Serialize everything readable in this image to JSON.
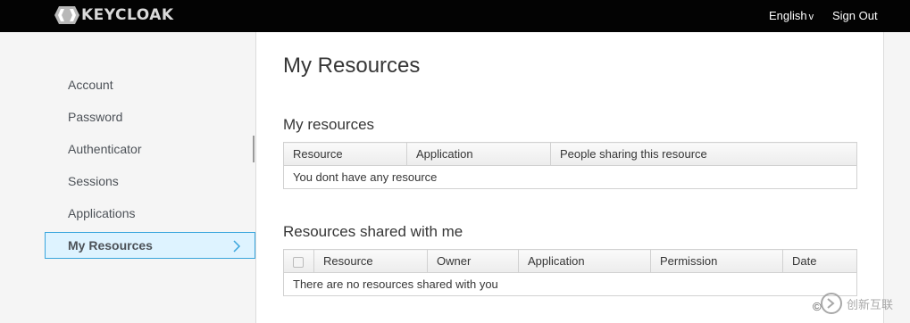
{
  "header": {
    "brand": "KEYCLOAK",
    "language": "English",
    "signout_label": "Sign Out"
  },
  "sidebar": {
    "items": [
      {
        "label": "Account"
      },
      {
        "label": "Password"
      },
      {
        "label": "Authenticator"
      },
      {
        "label": "Sessions"
      },
      {
        "label": "Applications"
      },
      {
        "label": "My Resources"
      }
    ]
  },
  "main": {
    "title": "My Resources",
    "my_resources": {
      "title": "My resources",
      "columns": [
        "Resource",
        "Application",
        "People sharing this resource"
      ],
      "empty": "You dont have any resource"
    },
    "shared_with_me": {
      "title": "Resources shared with me",
      "columns": [
        "Resource",
        "Owner",
        "Application",
        "Permission",
        "Date"
      ],
      "empty": "There are no resources shared with you"
    }
  },
  "watermark": {
    "text": "创新互联"
  },
  "colors": {
    "topbar": "#030303",
    "active_bg": "#def3ff",
    "active_border": "#39a5dc"
  }
}
